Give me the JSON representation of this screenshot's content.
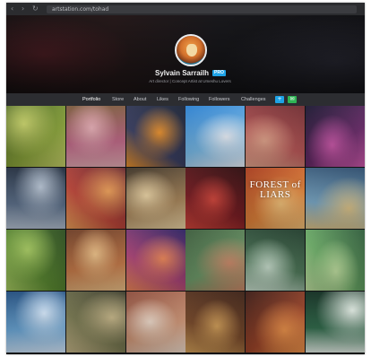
{
  "browser": {
    "url": "artstation.com/tohad"
  },
  "profile": {
    "name": "Sylvain Sarrailh",
    "badge": "PRO",
    "subtitle": "Art director | Concept Artist at Umeshu Lovers"
  },
  "nav": {
    "items": [
      {
        "label": "Portfolio"
      },
      {
        "label": "Store"
      },
      {
        "label": "About"
      },
      {
        "label": "Likes"
      },
      {
        "label": "Following"
      },
      {
        "label": "Followers"
      },
      {
        "label": "Challenges"
      }
    ],
    "follow_icon": "add-user-icon",
    "message_icon": "message-icon"
  },
  "gallery": {
    "tiles": [
      {
        "name": "artwork-forest-creature",
        "colors": [
          "#3f5a1e",
          "#8aa43a",
          "#c9d36a"
        ]
      },
      {
        "name": "artwork-pink-tree-cliff",
        "colors": [
          "#7a5a3c",
          "#c46a8a",
          "#e9b0b8"
        ]
      },
      {
        "name": "artwork-fire-cave",
        "colors": [
          "#1a2233",
          "#3a3f63",
          "#f0952e"
        ]
      },
      {
        "name": "artwork-cloud-sky",
        "colors": [
          "#2a7fd0",
          "#7cc0ef",
          "#f1f6ff"
        ]
      },
      {
        "name": "artwork-red-sky-birds",
        "colors": [
          "#6e2b30",
          "#c05a5a",
          "#e8a98f"
        ]
      },
      {
        "name": "artwork-neon-city",
        "colors": [
          "#1a1730",
          "#6a2b6a",
          "#d35bb0"
        ]
      },
      {
        "name": "artwork-ruins-arch",
        "colors": [
          "#1f2a3a",
          "#5b6f8a",
          "#b9c6d6"
        ]
      },
      {
        "name": "artwork-sunset-dunes",
        "colors": [
          "#5a1f2a",
          "#c0473a",
          "#f1a35a"
        ]
      },
      {
        "name": "artwork-rock-canyon",
        "colors": [
          "#3c3226",
          "#a9865a",
          "#f0d8a8"
        ]
      },
      {
        "name": "artwork-red-corridor",
        "colors": [
          "#2a0a0c",
          "#7a1c22",
          "#d6463b"
        ]
      },
      {
        "name": "artwork-forest-of-liars",
        "colors": [
          "#a63a1c",
          "#e4843a",
          "#f6c47a"
        ],
        "title": "FOREST of LIARS"
      },
      {
        "name": "artwork-coast-village",
        "colors": [
          "#2b4a6a",
          "#7aa9c8",
          "#e3c88a"
        ]
      },
      {
        "name": "artwork-green-fields",
        "colors": [
          "#2a4a1e",
          "#5c8c32",
          "#a8cc62"
        ]
      },
      {
        "name": "artwork-old-town-street",
        "colors": [
          "#6a3b24",
          "#c77a48",
          "#f0c48a"
        ]
      },
      {
        "name": "artwork-red-rock-peak",
        "colors": [
          "#2a2060",
          "#b0467a",
          "#f38a5a"
        ]
      },
      {
        "name": "artwork-floating-islands",
        "colors": [
          "#3a5a3a",
          "#6f9c6a",
          "#d08a6a"
        ]
      },
      {
        "name": "artwork-waterfall-cliff",
        "colors": [
          "#1f3a2a",
          "#4f7a5a",
          "#cde3d2"
        ]
      },
      {
        "name": "artwork-sky-birds-green",
        "colors": [
          "#2e5a3a",
          "#6fb06a",
          "#c6e6a5"
        ]
      },
      {
        "name": "artwork-blue-towers",
        "colors": [
          "#1f4a7a",
          "#6aa7d8",
          "#d9ecff"
        ]
      },
      {
        "name": "artwork-market-alley",
        "colors": [
          "#3a3a2a",
          "#7a7a52",
          "#c9b98a"
        ]
      },
      {
        "name": "artwork-white-temple",
        "colors": [
          "#8a4a3a",
          "#d49a7a",
          "#f3dfcf"
        ]
      },
      {
        "name": "artwork-tavern-interior",
        "colors": [
          "#3a1f14",
          "#7a4a2a",
          "#d7a25a"
        ]
      },
      {
        "name": "artwork-orange-sunset-road",
        "colors": [
          "#3a1a14",
          "#a0462a",
          "#f0944a"
        ]
      },
      {
        "name": "artwork-white-portal",
        "colors": [
          "#0f2a1e",
          "#2f6a4a",
          "#e8f2ea"
        ]
      }
    ]
  }
}
